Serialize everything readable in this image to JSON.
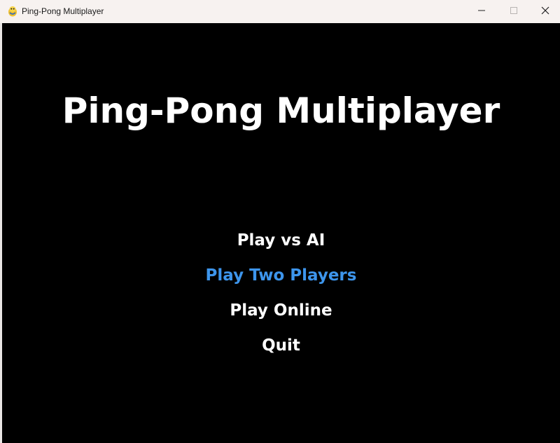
{
  "window": {
    "title": "Ping-Pong Multiplayer",
    "app_icon": "pygame-snake-icon",
    "controls": {
      "minimize_icon": "minimize-icon",
      "maximize_icon": "maximize-icon",
      "close_icon": "close-icon"
    }
  },
  "game": {
    "title": "Ping-Pong Multiplayer",
    "menu": [
      {
        "label": "Play vs AI",
        "selected": false
      },
      {
        "label": "Play Two Players",
        "selected": true
      },
      {
        "label": "Play Online",
        "selected": false
      },
      {
        "label": "Quit",
        "selected": false
      }
    ]
  },
  "colors": {
    "background": "#000000",
    "text": "#ffffff",
    "selected": "#3d95ec",
    "titlebar": "#f7f2f0"
  }
}
